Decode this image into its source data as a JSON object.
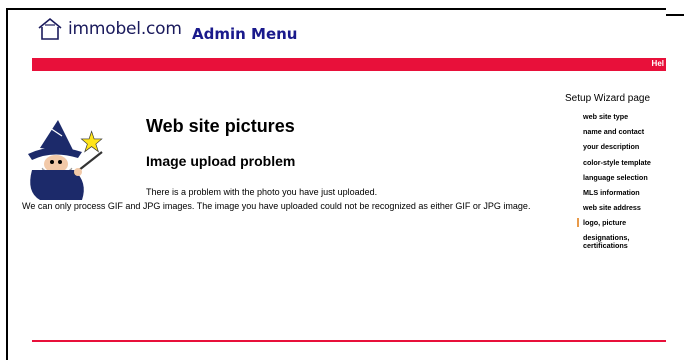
{
  "header": {
    "logo_text": "immobel.com",
    "title": "Admin Menu"
  },
  "red_bar": {
    "link_label": "Hel"
  },
  "main": {
    "heading": "Web site pictures",
    "subheading": "Image upload problem",
    "message_line1": "There is a problem with the photo you have just uploaded.",
    "message_line2": "We can only process GIF and JPG images. The image you have uploaded could not be recognized as either GIF or JPG image."
  },
  "sidebar": {
    "title": "Setup Wizard page",
    "items": [
      {
        "label": "web site type"
      },
      {
        "label": "name and contact"
      },
      {
        "label": "your description"
      },
      {
        "label": "color-style template"
      },
      {
        "label": "language selection"
      },
      {
        "label": "MLS information"
      },
      {
        "label": "web site address"
      },
      {
        "label": "logo, picture"
      },
      {
        "label": "designations, certifications"
      }
    ],
    "active_index": 7
  },
  "colors": {
    "accent_red": "#e8103a",
    "title_blue": "#1a1a8c",
    "active_marker": "#e89a4a"
  },
  "icons": {
    "logo": "house-logo-icon",
    "wizard": "wizard-illustration"
  }
}
